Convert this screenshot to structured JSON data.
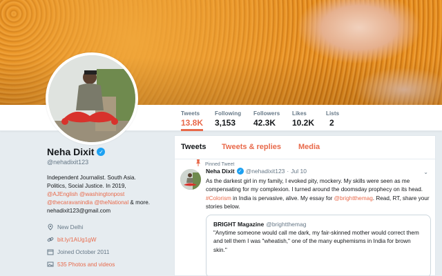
{
  "profile": {
    "name": "Neha Dixit",
    "handle": "@nehadixit123",
    "bio_line1": "Independent Journalist. South Asia.",
    "bio_line2": "Politics, Social Justice. In 2019,",
    "bio_link1": "@AJEnglish",
    "bio_link2": "@washingtonpost",
    "bio_link3": "@thecaravanindia",
    "bio_link4": "@theNational",
    "bio_more": " & more.",
    "bio_email": "nehadixit123@gmail.com",
    "location": "New Delhi",
    "website": "bit.ly/1AUg1gW",
    "joined": "Joined October 2011",
    "photos": "535 Photos and videos"
  },
  "stats": [
    {
      "label": "Tweets",
      "value": "13.8K"
    },
    {
      "label": "Following",
      "value": "3,153"
    },
    {
      "label": "Followers",
      "value": "42.3K"
    },
    {
      "label": "Likes",
      "value": "10.2K"
    },
    {
      "label": "Lists",
      "value": "2"
    }
  ],
  "tabs": {
    "tweets": "Tweets",
    "replies": "Tweets & replies",
    "media": "Media"
  },
  "tweet": {
    "pinned_label": "Pinned Tweet",
    "name": "Neha Dixit",
    "handle": "@nehadixit123",
    "sep": "·",
    "time": "Jul 10",
    "text1": "As the darkest girl in my family, I evoked pity, mockery. My skills were seen as me compensating for my complexion. I turned around the doomsday prophecy on its head. ",
    "hashtag": "#Colorism",
    "text2": " in India is pervasive, alive. My essay for ",
    "mention": "@brightthemag",
    "text3": ". Read, RT, share your stories below.",
    "quote": {
      "name": "BRIGHT Magazine",
      "handle": "@brightthemag",
      "text": "\"Anytime someone would call me dark, my fair-skinned mother would correct them and tell them I was \"wheatish,\" one of the many euphemisms in India for brown skin.\""
    }
  },
  "colors": {
    "accent": "#e8694a",
    "verified": "#1da1f2"
  }
}
